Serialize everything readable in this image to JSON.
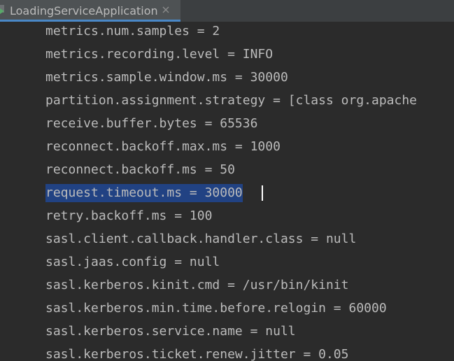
{
  "tab": {
    "title": "LoadingServiceApplication",
    "icon": "run-icon",
    "close_icon": "close-icon"
  },
  "console": {
    "lines": [
      "metrics.num.samples = 2",
      "metrics.recording.level = INFO",
      "metrics.sample.window.ms = 30000",
      "partition.assignment.strategy = [class org.apache",
      "receive.buffer.bytes = 65536",
      "reconnect.backoff.max.ms = 1000",
      "reconnect.backoff.ms = 50",
      "request.timeout.ms = 30000",
      "retry.backoff.ms = 100",
      "sasl.client.callback.handler.class = null",
      "sasl.jaas.config = null",
      "sasl.kerberos.kinit.cmd = /usr/bin/kinit",
      "sasl.kerberos.min.time.before.relogin = 60000",
      "sasl.kerberos.service.name = null",
      "sasl.kerberos.ticket.renew.jitter = 0.05"
    ],
    "selected_line": 7
  },
  "colors": {
    "background": "#2b2b2b",
    "text": "#bbbbbb",
    "selection": "#214283",
    "tab_active": "#4e5254",
    "tab_underline": "#4a88c7"
  }
}
